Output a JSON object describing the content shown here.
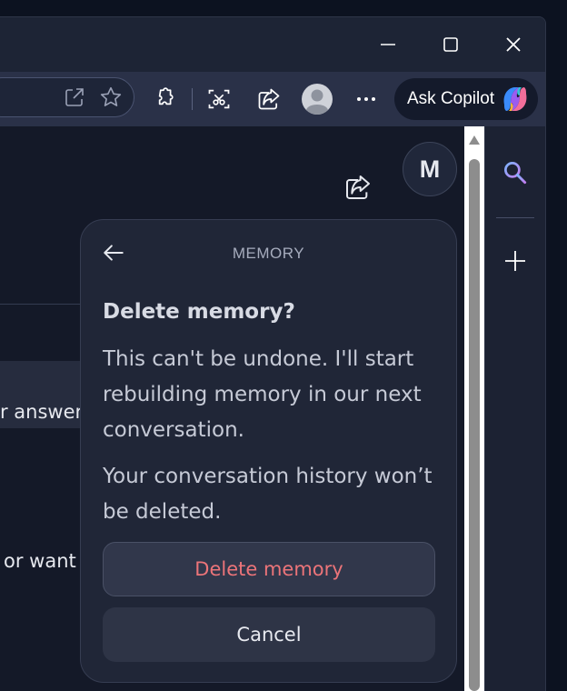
{
  "window": {
    "controls": {
      "minimize_icon": "minimize-icon",
      "maximize_icon": "maximize-icon",
      "close_icon": "close-icon"
    }
  },
  "toolbar": {
    "icons": [
      "open-external-icon",
      "favorite-star-icon",
      "extensions-icon",
      "screenshot-icon",
      "share-icon",
      "profile-avatar-icon",
      "more-icon"
    ],
    "copilot_label": "Ask Copilot"
  },
  "page": {
    "partial_text_1": "r answer",
    "partial_text_2": "or want",
    "avatar_letter": "M"
  },
  "memory_panel": {
    "title": "MEMORY",
    "heading": "Delete memory?",
    "body1": "This can't be undone. I'll start rebuilding memory in our next conversation.",
    "body2": "Your conversation history won’t be deleted.",
    "delete_label": "Delete memory",
    "cancel_label": "Cancel"
  },
  "sidebar": {
    "icons": [
      "search-icon",
      "add-icon"
    ]
  },
  "colors": {
    "accent_delete": "#ec7479",
    "panel_bg": "#202637",
    "toolbar_bg": "#2a3148"
  }
}
